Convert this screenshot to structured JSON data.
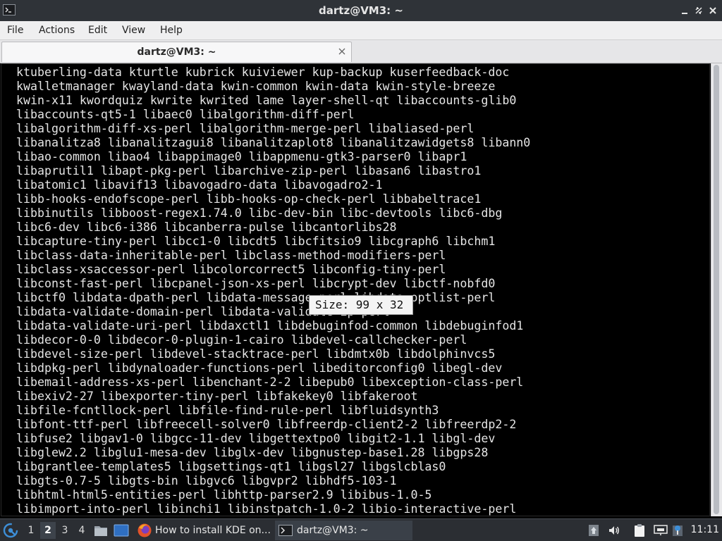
{
  "window": {
    "title": "dartz@VM3: ~"
  },
  "menubar": {
    "items": [
      "File",
      "Actions",
      "Edit",
      "View",
      "Help"
    ]
  },
  "tab": {
    "label": "dartz@VM3: ~"
  },
  "terminal": {
    "lines": [
      "ktuberling-data kturtle kubrick kuiviewer kup-backup kuserfeedback-doc",
      "kwalletmanager kwayland-data kwin-common kwin-data kwin-style-breeze",
      "kwin-x11 kwordquiz kwrite kwrited lame layer-shell-qt libaccounts-glib0",
      "libaccounts-qt5-1 libaec0 libalgorithm-diff-perl",
      "libalgorithm-diff-xs-perl libalgorithm-merge-perl libaliased-perl",
      "libanalitza8 libanalitzagui8 libanalitzaplot8 libanalitzawidgets8 libann0",
      "libao-common libao4 libappimage0 libappmenu-gtk3-parser0 libapr1",
      "libaprutil1 libapt-pkg-perl libarchive-zip-perl libasan6 libastro1",
      "libatomic1 libavif13 libavogadro-data libavogadro2-1",
      "libb-hooks-endofscope-perl libb-hooks-op-check-perl libbabeltrace1",
      "libbinutils libboost-regex1.74.0 libc-dev-bin libc-devtools libc6-dbg",
      "libc6-dev libc6-i386 libcanberra-pulse libcantorlibs28",
      "libcapture-tiny-perl libcc1-0 libcdt5 libcfitsio9 libcgraph6 libchm1",
      "libclass-data-inheritable-perl libclass-method-modifiers-perl",
      "libclass-xsaccessor-perl libcolorcorrect5 libconfig-tiny-perl",
      "libconst-fast-perl libcpanel-json-xs-perl libcrypt-dev libctf-nobfd0",
      "libctf0 libdata-dpath-perl libdata-message-perl libdata-optlist-perl",
      "libdata-validate-domain-perl libdata-validate-ip-perl",
      "libdata-validate-uri-perl libdaxctl1 libdebuginfod-common libdebuginfod1",
      "libdecor-0-0 libdecor-0-plugin-1-cairo libdevel-callchecker-perl",
      "libdevel-size-perl libdevel-stacktrace-perl libdmtx0b libdolphinvcs5",
      "libdpkg-perl libdynaloader-functions-perl libeditorconfig0 libegl-dev",
      "libemail-address-xs-perl libenchant-2-2 libepub0 libexception-class-perl",
      "libexiv2-27 libexporter-tiny-perl libfakekey0 libfakeroot",
      "libfile-fcntllock-perl libfile-find-rule-perl libfluidsynth3",
      "libfont-ttf-perl libfreecell-solver0 libfreerdp-client2-2 libfreerdp2-2",
      "libfuse2 libgav1-0 libgcc-11-dev libgettextpo0 libgit2-1.1 libgl-dev",
      "libglew2.2 libglu1-mesa-dev libglx-dev libgnustep-base1.28 libgps28",
      "libgrantlee-templates5 libgsettings-qt1 libgsl27 libgslcblas0",
      "libgts-0.7-5 libgts-bin libgvc6 libgvpr2 libhdf5-103-1",
      "libhtml-html5-entities-perl libhttp-parser2.9 libibus-1.0-5",
      "libimport-into-perl libinchi1 libinstpatch-1.0-2 libio-interactive-perl"
    ]
  },
  "size_tooltip": "Size: 99 x 32",
  "taskbar": {
    "workspaces": [
      "1",
      "2",
      "3",
      "4"
    ],
    "active_workspace": "2",
    "tasks": [
      {
        "label": "How to install KDE on..."
      },
      {
        "label": "dartz@VM3: ~"
      }
    ],
    "clock": "11:11"
  }
}
